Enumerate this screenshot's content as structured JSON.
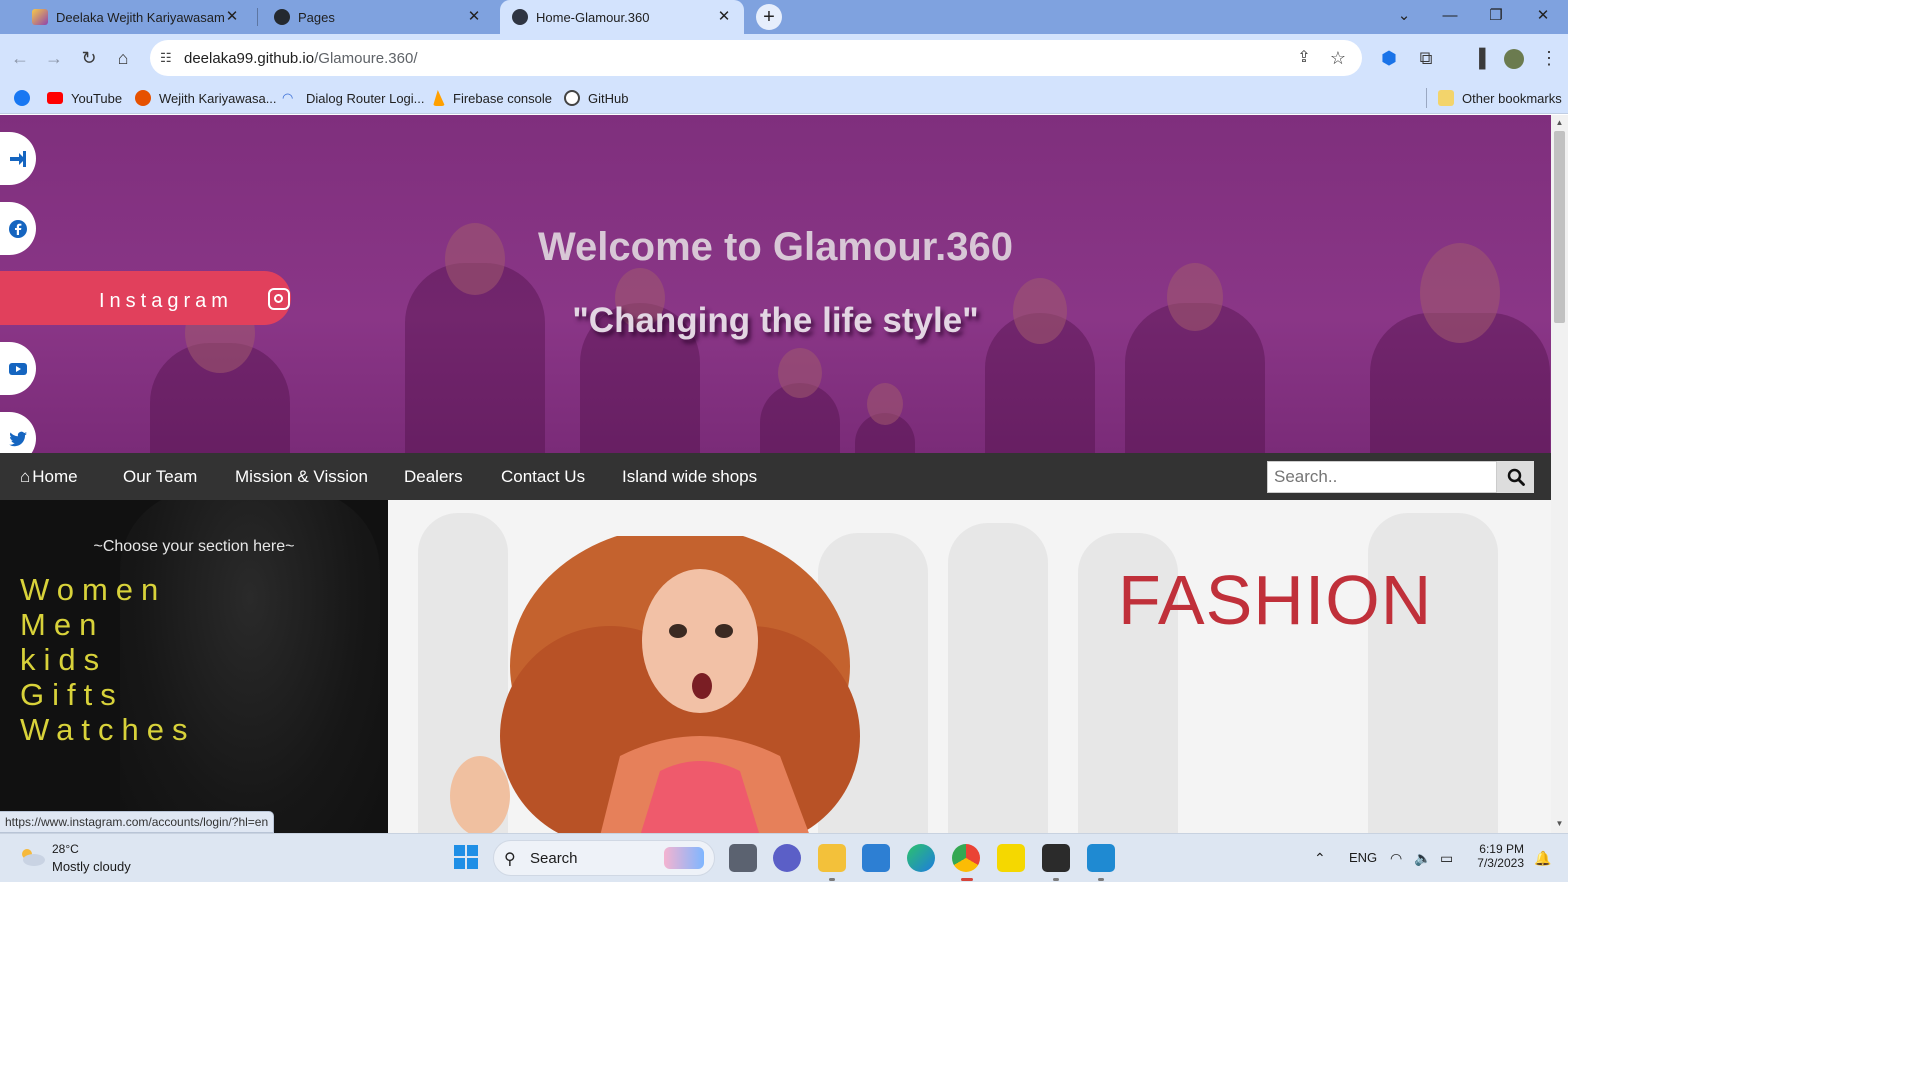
{
  "browser": {
    "tabs": [
      {
        "title": "Deelaka Wejith Kariyawasam's Portfolio",
        "active": false
      },
      {
        "title": "Pages",
        "active": false
      },
      {
        "title": "Home-Glamour.360",
        "active": true
      }
    ],
    "new_tab_glyph": "+",
    "window_controls": {
      "minimize": "—",
      "maximize": "❐",
      "close": "✕"
    },
    "url_host": "deelaka99.github.io",
    "url_path": "/Glamoure.360/",
    "bookmarks": [
      {
        "label": "",
        "icon": "facebook-icon",
        "color": "#1877f2"
      },
      {
        "label": "YouTube",
        "icon": "youtube-icon",
        "color": "#ff0000"
      },
      {
        "label": "Wejith Kariyawasa...",
        "icon": "portfolio-icon",
        "color": "#e65100"
      },
      {
        "label": "Dialog Router Logi...",
        "icon": "wifi-icon",
        "color": "#3b6fd6"
      },
      {
        "label": "Firebase console",
        "icon": "firebase-icon",
        "color": "#ffa000"
      },
      {
        "label": "GitHub",
        "icon": "github-icon",
        "color": "#444444"
      }
    ],
    "other_bookmarks": "Other bookmarks",
    "status_url": "https://www.instagram.com/accounts/login/?hl=en"
  },
  "site": {
    "hero_title": "Welcome to Glamour.360",
    "hero_subtitle": "\"Changing the life style\"",
    "instagram_label": "Instagram",
    "nav": {
      "items": [
        "Home",
        "Our Team",
        "Mission & Vission",
        "Dealers",
        "Contact Us",
        "Island wide shops"
      ],
      "search_placeholder": "Search.."
    },
    "sidebar": {
      "caption": "~Choose your section here~",
      "sections": [
        "Women",
        "Men",
        "kids",
        "Gifts",
        "Watches"
      ]
    },
    "banner_text": "FASHION",
    "colors": {
      "hero": "#8a3687",
      "nav": "#333333",
      "instagram": "#e1405c",
      "sections": "#d8d23a",
      "banner_text": "#c0303a"
    }
  },
  "taskbar": {
    "temperature": "28°C",
    "weather": "Mostly cloudy",
    "search_label": "Search",
    "language": "ENG",
    "time": "6:19 PM",
    "date": "7/3/2023"
  }
}
